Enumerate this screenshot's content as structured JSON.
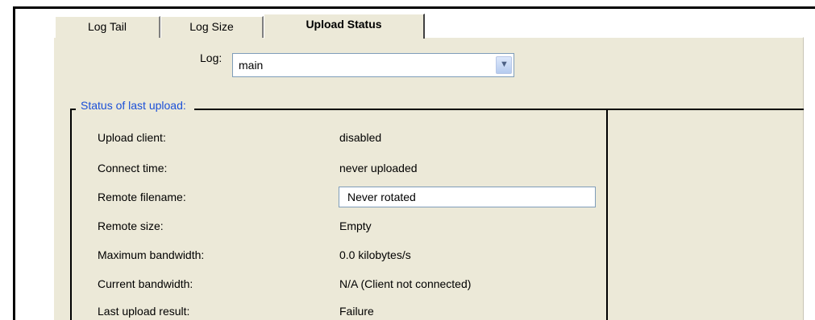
{
  "tabs": [
    {
      "label": "Log Tail",
      "active": false
    },
    {
      "label": "Log Size",
      "active": false
    },
    {
      "label": "Upload Status",
      "active": true
    }
  ],
  "log": {
    "label": "Log:",
    "value": "main"
  },
  "group": {
    "title": "Status of last upload:"
  },
  "rows": [
    {
      "label": "Upload client:",
      "value": "disabled"
    },
    {
      "label": "Connect time:",
      "value": "never uploaded"
    },
    {
      "label": "Remote filename:",
      "value": "Never rotated"
    },
    {
      "label": "Remote size:",
      "value": "Empty"
    },
    {
      "label": "Maximum bandwidth:",
      "value": "0.0 kilobytes/s"
    },
    {
      "label": "Current bandwidth:",
      "value": "N/A (Client not connected)"
    },
    {
      "label": "Last upload result:",
      "value": "Failure"
    }
  ],
  "colors": {
    "group_title": "#1a4fd8",
    "panel_bg": "#ece9d8"
  },
  "icons": {
    "dropdown": "chevron-down-icon"
  }
}
